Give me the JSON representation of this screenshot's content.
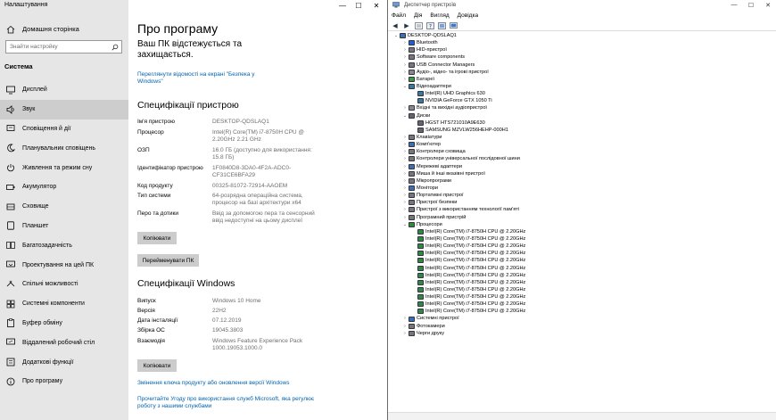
{
  "settings": {
    "app_title": "Налаштування",
    "home_label": "Домашня сторінка",
    "search_placeholder": "Знайти настройку",
    "section_label": "Система",
    "nav": [
      {
        "label": "Дисплей",
        "icon": "display-icon"
      },
      {
        "label": "Звук",
        "icon": "speaker-icon"
      },
      {
        "label": "Сповіщення й дії",
        "icon": "notification-icon"
      },
      {
        "label": "Планувальник сповіщень",
        "icon": "moon-icon"
      },
      {
        "label": "Живлення та режим сну",
        "icon": "power-icon"
      },
      {
        "label": "Акумулятор",
        "icon": "battery-icon"
      },
      {
        "label": "Сховище",
        "icon": "storage-icon"
      },
      {
        "label": "Планшет",
        "icon": "tablet-icon"
      },
      {
        "label": "Багатозадачність",
        "icon": "multitask-icon"
      },
      {
        "label": "Проектування на цей ПК",
        "icon": "project-icon"
      },
      {
        "label": "Спільні можливості",
        "icon": "shared-icon"
      },
      {
        "label": "Системні компоненти",
        "icon": "components-icon"
      },
      {
        "label": "Буфер обміну",
        "icon": "clipboard-icon"
      },
      {
        "label": "Віддалений робочий стіл",
        "icon": "remote-icon"
      },
      {
        "label": "Додаткові функції",
        "icon": "features-icon"
      },
      {
        "label": "Про програму",
        "icon": "info-icon"
      }
    ],
    "page_title": "Про програму",
    "protect_text": "Ваш ПК відстежується та захищається.",
    "security_link": "Переглянути відомості на екрані \"Безпека у Windows\"",
    "device_spec_title": "Специфікації пристрою",
    "device_spec": [
      {
        "k": "Ім'я пристрою",
        "v": "DESKTOP-QDSLAQ1"
      },
      {
        "k": "Процесор",
        "v": "Intel(R) Core(TM) i7-8750H CPU @ 2.20GHz   2.21 GHz"
      },
      {
        "k": "ОЗП",
        "v": "16.0 ГБ (доступно для використання: 15.8 ГБ)"
      },
      {
        "k": "Ідентифікатор пристрою",
        "v": "1F0840D8-3DA0-4F2A-ADC0-CF31CE6BFA29"
      },
      {
        "k": "Код продукту",
        "v": "00325-81072-72914-AAOEM"
      },
      {
        "k": "Тип системи",
        "v": "64-розрядна операційна система, процесор на базі архітектури x64"
      },
      {
        "k": "Перо та дотики",
        "v": "Ввід за допомогою пера та сенсорний ввід недоступні на цьому дисплеї"
      }
    ],
    "copy_button": "Копіювати",
    "rename_button": "Перейменувати ПК",
    "windows_spec_title": "Специфікації Windows",
    "windows_spec": [
      {
        "k": "Випуск",
        "v": "Windows 10 Home"
      },
      {
        "k": "Версія",
        "v": "22H2"
      },
      {
        "k": "Дата інсталяції",
        "v": "07.12.2019"
      },
      {
        "k": "Збірка ОС",
        "v": "19045.3803"
      },
      {
        "k": "Взаємодія",
        "v": "Windows Feature Experience Pack 1000.19053.1000.0"
      }
    ],
    "copy_button2": "Копіювати",
    "link_product_key": "Змінення ключа продукту або оновлення версії Windows",
    "link_agreement": "Прочитайте Угоду про використання служб Microsoft, яка регулює роботу з нашими службами"
  },
  "devmgr": {
    "title": "Диспетчер пристроїв",
    "menu": [
      "Файл",
      "Дія",
      "Вигляд",
      "Довідка"
    ],
    "tree": [
      {
        "t": "DESKTOP-QDSLAQ1",
        "lvl": 0,
        "exp": "v",
        "c": "#3a6fb0"
      },
      {
        "t": "Bluetooth",
        "lvl": 1,
        "exp": ">",
        "c": "#1f5fcf"
      },
      {
        "t": "HID-пристрої",
        "lvl": 1,
        "exp": ">",
        "c": "#777"
      },
      {
        "t": "Software components",
        "lvl": 1,
        "exp": ">",
        "c": "#777"
      },
      {
        "t": "USB Connector Managers",
        "lvl": 1,
        "exp": ">",
        "c": "#777"
      },
      {
        "t": "Аудіо-, відео- та ігрові пристрої",
        "lvl": 1,
        "exp": ">",
        "c": "#888"
      },
      {
        "t": "Батареї",
        "lvl": 1,
        "exp": ">",
        "c": "#3c9a3c"
      },
      {
        "t": "Відеоадаптери",
        "lvl": 1,
        "exp": "v",
        "c": "#3a7a9a"
      },
      {
        "t": "Intel(R) UHD Graphics 630",
        "lvl": 2,
        "exp": "",
        "c": "#3a7a9a"
      },
      {
        "t": "NVIDIA GeForce GTX 1050 Ti",
        "lvl": 2,
        "exp": "",
        "c": "#3a7a9a"
      },
      {
        "t": "Вхідні та вихідні аудіопристрої",
        "lvl": 1,
        "exp": ">",
        "c": "#888"
      },
      {
        "t": "Диски",
        "lvl": 1,
        "exp": "v",
        "c": "#666"
      },
      {
        "t": "HGST HTS721010A9E630",
        "lvl": 2,
        "exp": "",
        "c": "#666"
      },
      {
        "t": "SAMSUNG MZVLW256HEHP-000H1",
        "lvl": 2,
        "exp": "",
        "c": "#666"
      },
      {
        "t": "Клавіатури",
        "lvl": 1,
        "exp": ">",
        "c": "#777"
      },
      {
        "t": "Комп'ютер",
        "lvl": 1,
        "exp": ">",
        "c": "#3a6fb0"
      },
      {
        "t": "Контролери сховища",
        "lvl": 1,
        "exp": ">",
        "c": "#777"
      },
      {
        "t": "Контролери універсальної послідовної шини",
        "lvl": 1,
        "exp": ">",
        "c": "#777"
      },
      {
        "t": "Мережеві адаптери",
        "lvl": 1,
        "exp": ">",
        "c": "#3a6fb0"
      },
      {
        "t": "Миша й інші вказівні пристрої",
        "lvl": 1,
        "exp": ">",
        "c": "#777"
      },
      {
        "t": "Мікропрограми",
        "lvl": 1,
        "exp": ">",
        "c": "#777"
      },
      {
        "t": "Монітори",
        "lvl": 1,
        "exp": ">",
        "c": "#3a6fb0"
      },
      {
        "t": "Портативні пристрої",
        "lvl": 1,
        "exp": ">",
        "c": "#777"
      },
      {
        "t": "Пристрої безпеки",
        "lvl": 1,
        "exp": ">",
        "c": "#777"
      },
      {
        "t": "Пристрої з використанням технології пам'яті",
        "lvl": 1,
        "exp": ">",
        "c": "#777"
      },
      {
        "t": "Програмний пристрій",
        "lvl": 1,
        "exp": ">",
        "c": "#777"
      },
      {
        "t": "Процесори",
        "lvl": 1,
        "exp": "v",
        "c": "#2f8a3f"
      },
      {
        "t": "Intel(R) Core(TM) i7-8750H CPU @ 2.20GHz",
        "lvl": 2,
        "exp": "",
        "c": "#2f8a3f"
      },
      {
        "t": "Intel(R) Core(TM) i7-8750H CPU @ 2.20GHz",
        "lvl": 2,
        "exp": "",
        "c": "#2f8a3f"
      },
      {
        "t": "Intel(R) Core(TM) i7-8750H CPU @ 2.20GHz",
        "lvl": 2,
        "exp": "",
        "c": "#2f8a3f"
      },
      {
        "t": "Intel(R) Core(TM) i7-8750H CPU @ 2.20GHz",
        "lvl": 2,
        "exp": "",
        "c": "#2f8a3f"
      },
      {
        "t": "Intel(R) Core(TM) i7-8750H CPU @ 2.20GHz",
        "lvl": 2,
        "exp": "",
        "c": "#2f8a3f"
      },
      {
        "t": "Intel(R) Core(TM) i7-8750H CPU @ 2.20GHz",
        "lvl": 2,
        "exp": "",
        "c": "#2f8a3f"
      },
      {
        "t": "Intel(R) Core(TM) i7-8750H CPU @ 2.20GHz",
        "lvl": 2,
        "exp": "",
        "c": "#2f8a3f"
      },
      {
        "t": "Intel(R) Core(TM) i7-8750H CPU @ 2.20GHz",
        "lvl": 2,
        "exp": "",
        "c": "#2f8a3f"
      },
      {
        "t": "Intel(R) Core(TM) i7-8750H CPU @ 2.20GHz",
        "lvl": 2,
        "exp": "",
        "c": "#2f8a3f"
      },
      {
        "t": "Intel(R) Core(TM) i7-8750H CPU @ 2.20GHz",
        "lvl": 2,
        "exp": "",
        "c": "#2f8a3f"
      },
      {
        "t": "Intel(R) Core(TM) i7-8750H CPU @ 2.20GHz",
        "lvl": 2,
        "exp": "",
        "c": "#2f8a3f"
      },
      {
        "t": "Intel(R) Core(TM) i7-8750H CPU @ 2.20GHz",
        "lvl": 2,
        "exp": "",
        "c": "#2f8a3f"
      },
      {
        "t": "Системні пристрої",
        "lvl": 1,
        "exp": ">",
        "c": "#3a6fb0"
      },
      {
        "t": "Фотокамери",
        "lvl": 1,
        "exp": ">",
        "c": "#777"
      },
      {
        "t": "Черги друку",
        "lvl": 1,
        "exp": ">",
        "c": "#777"
      }
    ]
  },
  "colors": {
    "accent": "#0063b1",
    "sidebar_bg": "#e6e6e6",
    "selected_bg": "#cdcdcd"
  }
}
